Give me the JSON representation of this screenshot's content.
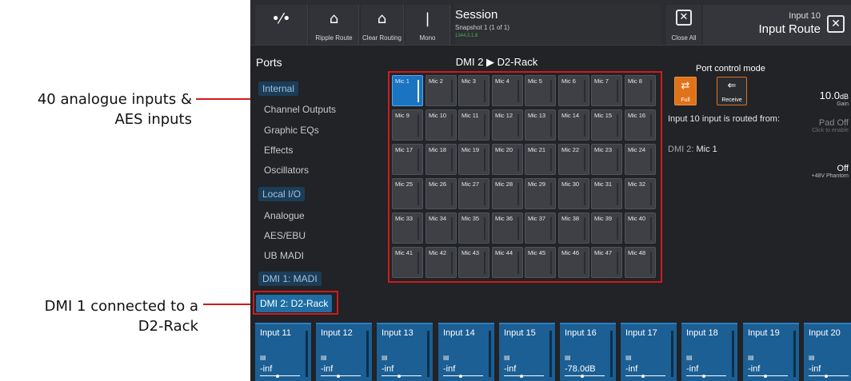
{
  "annotations": {
    "inputs": [
      "40 analogue inputs &",
      "AES inputs"
    ],
    "dmi": [
      "DMI 1 connected to a",
      "D2-Rack"
    ],
    "line_color": "#d11a1a"
  },
  "toolbar": {
    "routing_icon": "routing-nodes-icon",
    "ripple_route": "Ripple Route",
    "clear_routing": "Clear Routing",
    "mono": "Mono",
    "session_title": "Session",
    "session_snapshot": "Snapshot 1 (1 of 1)",
    "session_status": "1344.3.1.8",
    "close_all": "Close All",
    "input_number": "Input 10",
    "input_route": "Input Route"
  },
  "ports": {
    "title": "Ports",
    "items": [
      {
        "label": "Internal",
        "header": true
      },
      {
        "label": "Channel Outputs",
        "header": false
      },
      {
        "label": "Graphic EQs",
        "header": false
      },
      {
        "label": "Effects",
        "header": false
      },
      {
        "label": "Oscillators",
        "header": false
      },
      {
        "label": "Local I/O",
        "header": true
      },
      {
        "label": "Analogue",
        "header": false
      },
      {
        "label": "AES/EBU",
        "header": false
      },
      {
        "label": "UB MADI",
        "header": false
      },
      {
        "label": "DMI 1: MADI",
        "header": true
      }
    ],
    "selected": "DMI 2: D2-Rack"
  },
  "grid": {
    "title": "DMI 2 ▶ D2-Rack",
    "selected": "Mic 1",
    "cells": [
      "Mic 1",
      "Mic 2",
      "Mic 3",
      "Mic 4",
      "Mic 5",
      "Mic 6",
      "Mic 7",
      "Mic 8",
      "Mic 9",
      "Mic 10",
      "Mic 11",
      "Mic 12",
      "Mic 13",
      "Mic 14",
      "Mic 15",
      "Mic 16",
      "Mic 17",
      "Mic 18",
      "Mic 19",
      "Mic 20",
      "Mic 21",
      "Mic 22",
      "Mic 23",
      "Mic 24",
      "Mic 25",
      "Mic 26",
      "Mic 27",
      "Mic 28",
      "Mic 29",
      "Mic 30",
      "Mic 31",
      "Mic 32",
      "Mic 33",
      "Mic 34",
      "Mic 35",
      "Mic 36",
      "Mic 37",
      "Mic 38",
      "Mic 39",
      "Mic 40",
      "Mic 41",
      "Mic 42",
      "Mic 43",
      "Mic 44",
      "Mic 45",
      "Mic 46",
      "Mic 47",
      "Mic 48"
    ]
  },
  "panel": {
    "port_control_mode": "Port control mode",
    "full": "Full",
    "receive": "Receive",
    "routed_text": "Input 10 input is routed from:",
    "source_prefix": "DMI 2:",
    "source_name": "Mic 1",
    "gain_value": "10.0",
    "gain_unit": "dB",
    "gain_label": "Gain",
    "pad_value": "Pad Off",
    "pad_hint": "Click to enable",
    "phantom_value": "Off",
    "phantom_label": "+48V Phantom"
  },
  "channels": [
    {
      "name": "Input 11",
      "value": "-inf"
    },
    {
      "name": "Input 12",
      "value": "-inf"
    },
    {
      "name": "Input 13",
      "value": "-inf"
    },
    {
      "name": "Input 14",
      "value": "-inf"
    },
    {
      "name": "Input 15",
      "value": "-inf"
    },
    {
      "name": "Input 16",
      "value": "-78.0dB"
    },
    {
      "name": "Input 17",
      "value": "-inf"
    },
    {
      "name": "Input 18",
      "value": "-inf"
    },
    {
      "name": "Input 19",
      "value": "-inf"
    },
    {
      "name": "Input 20",
      "value": "-inf"
    }
  ],
  "colors": {
    "accent_blue": "#1e6ea3",
    "selected_cell": "#1a74c2",
    "orange": "#e0721a",
    "channel_blue": "#1b5f94"
  }
}
